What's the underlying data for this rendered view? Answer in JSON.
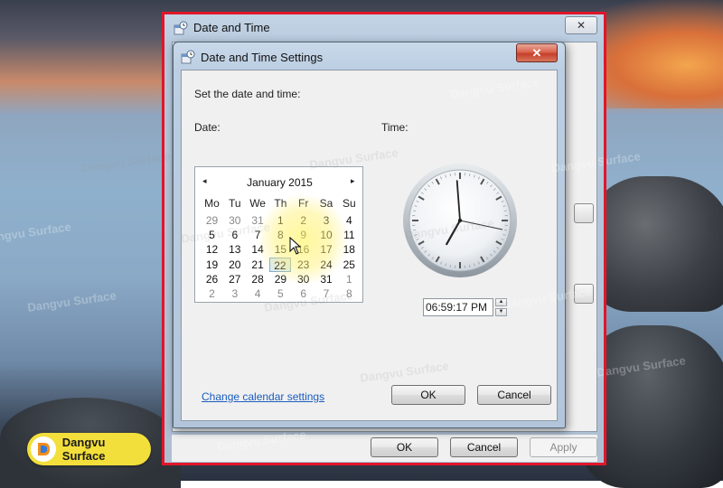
{
  "back_window": {
    "title": "Date and Time",
    "close_glyph": "✕",
    "buttons": {
      "ok": "OK",
      "cancel": "Cancel",
      "apply": "Apply"
    }
  },
  "dialog": {
    "title": "Date and Time Settings",
    "close_glyph": "✕",
    "instruction": "Set the date and time:",
    "date_label": "Date:",
    "time_label": "Time:",
    "calendar": {
      "month_label": "January 2015",
      "prev_glyph": "◂",
      "next_glyph": "▸",
      "weekdays": [
        "Mo",
        "Tu",
        "We",
        "Th",
        "Fr",
        "Sa",
        "Su"
      ],
      "weeks": [
        [
          "29",
          "30",
          "31",
          "1",
          "2",
          "3",
          "4"
        ],
        [
          "5",
          "6",
          "7",
          "8",
          "9",
          "10",
          "11"
        ],
        [
          "12",
          "13",
          "14",
          "15",
          "16",
          "17",
          "18"
        ],
        [
          "19",
          "20",
          "21",
          "22",
          "23",
          "24",
          "25"
        ],
        [
          "26",
          "27",
          "28",
          "29",
          "30",
          "31",
          "1"
        ],
        [
          "2",
          "3",
          "4",
          "5",
          "6",
          "7",
          "8"
        ]
      ],
      "selected_day": "22"
    },
    "clock": {
      "hours": 6,
      "minutes": 59,
      "seconds": 17
    },
    "time_value": "06:59:17 PM",
    "change_calendar_link": "Change calendar settings",
    "ok_label": "OK",
    "cancel_label": "Cancel"
  },
  "watermark_text": "Dangvu Surface",
  "brand": {
    "name": "Dangvu Surface",
    "accent": "#f3df3b"
  },
  "highlight_color": "#e0162b"
}
